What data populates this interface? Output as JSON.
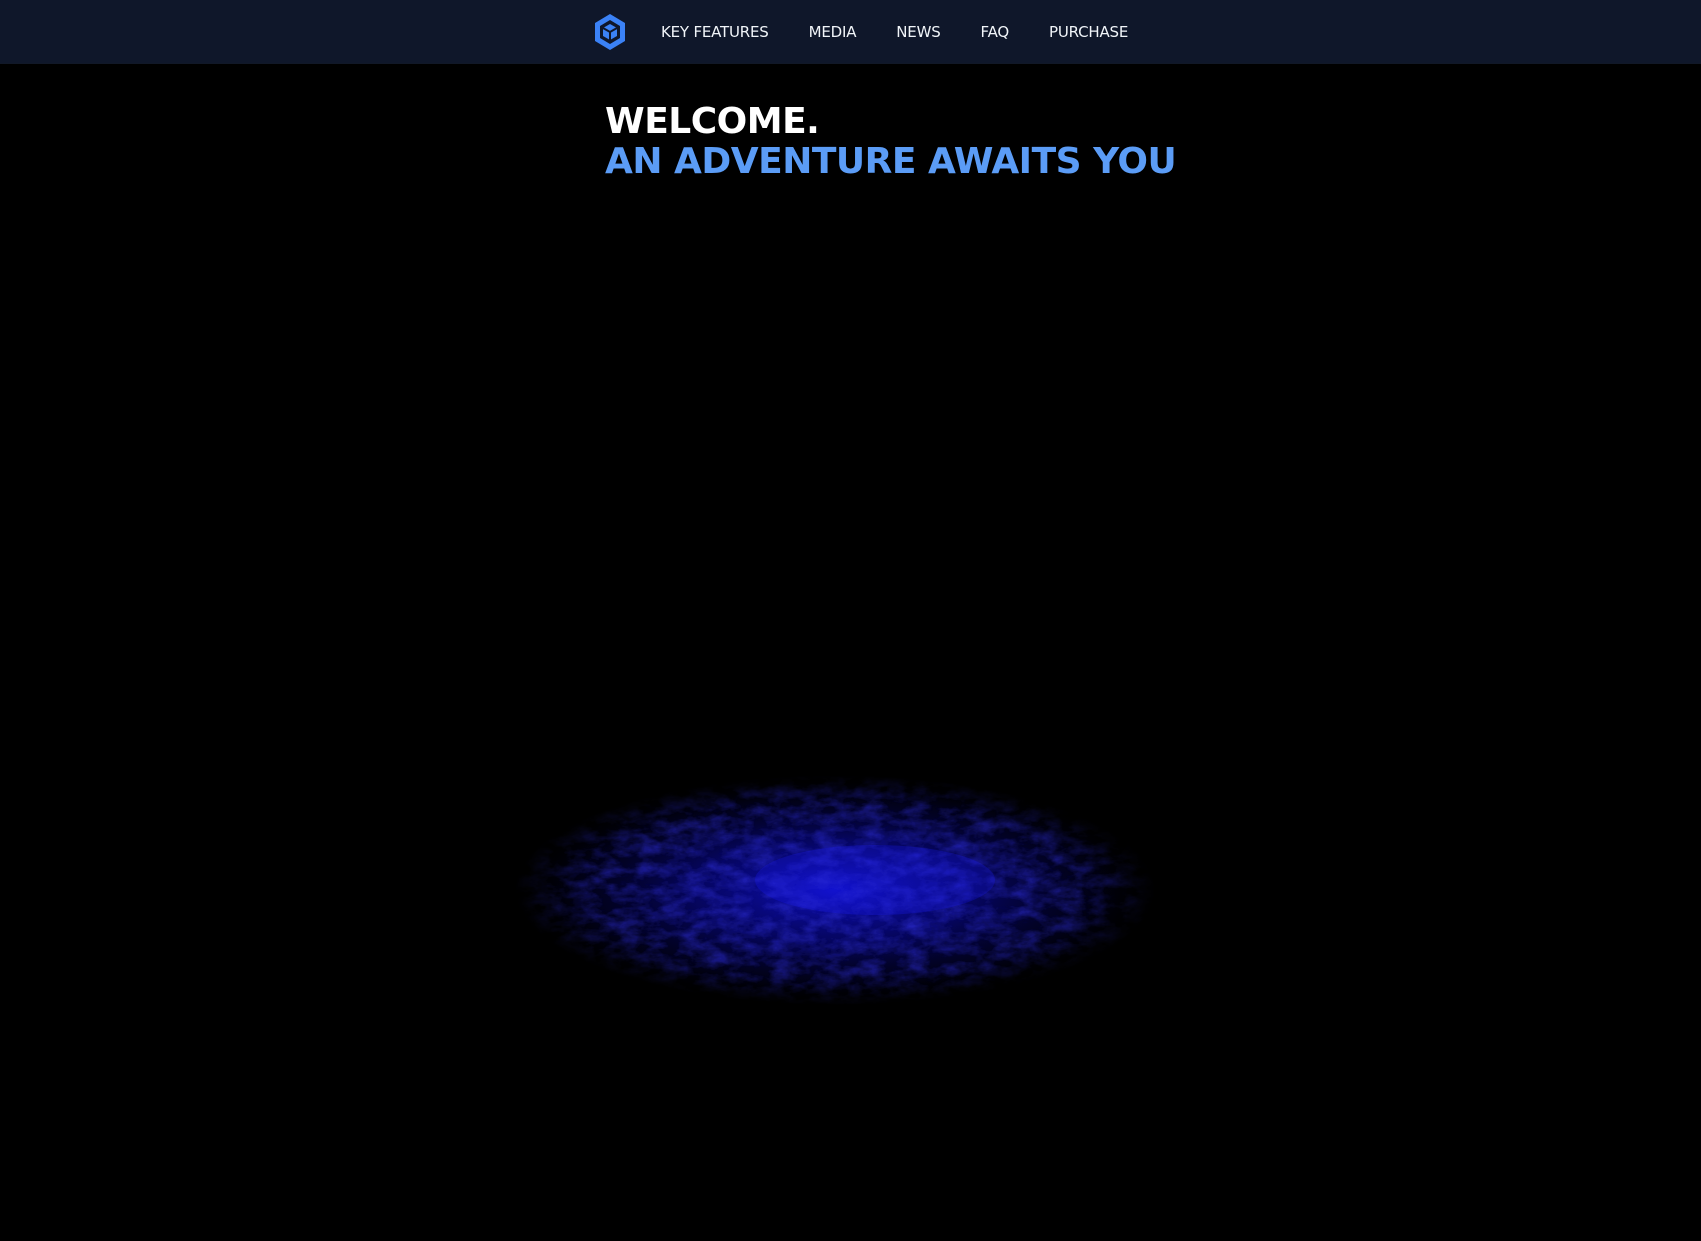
{
  "nav": {
    "logo_icon": "hexagon-cube-logo",
    "links": [
      {
        "label": "KEY FEATURES"
      },
      {
        "label": "MEDIA"
      },
      {
        "label": "NEWS"
      },
      {
        "label": "FAQ"
      },
      {
        "label": "PURCHASE"
      }
    ]
  },
  "hero": {
    "line1": "WELCOME.",
    "line2": "AN ADVENTURE AWAITS YOU"
  },
  "colors": {
    "background": "#000000",
    "navbar": "#0f172a",
    "accent": "#5b9cf6",
    "logo": "#3b82f6",
    "terrain_glow": "#1a1aff"
  }
}
